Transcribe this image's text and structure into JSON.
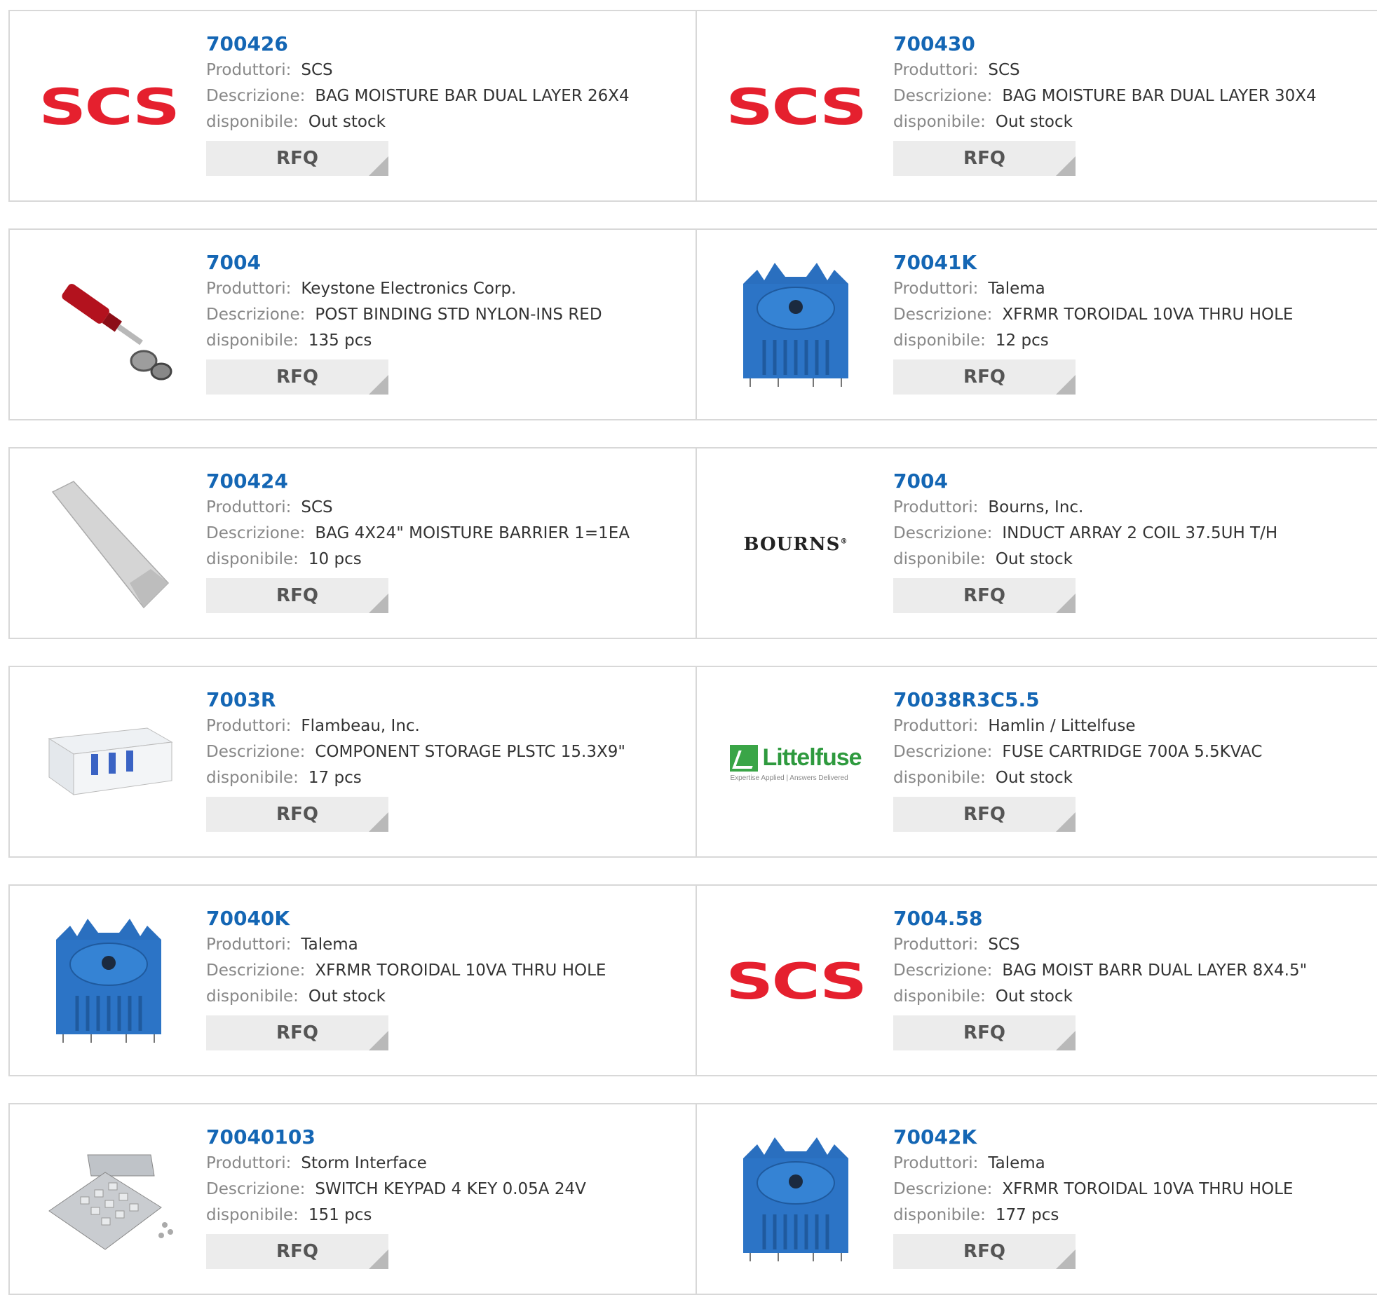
{
  "labels": {
    "manufacturer": "Produttori:",
    "description": "Descrizione:",
    "availability": "disponibile:"
  },
  "rfq_label": "RFQ",
  "brand_text": {
    "scs": "SCS",
    "bourns": "BOURNS",
    "littelfuse": "Littelfuse",
    "littelfuse_tagline": "Expertise Applied | Answers Delivered"
  },
  "colors": {
    "part_number": "#1466b4",
    "scs_red": "#e5202e",
    "littelfuse_green": "#2e9a3e",
    "talema_blue": "#2a6fbf"
  },
  "products": [
    {
      "pn": "700426",
      "manufacturer": "SCS",
      "description": "BAG MOISTURE BAR DUAL LAYER 26X4",
      "availability": "Out stock",
      "image": "scs-logo"
    },
    {
      "pn": "700430",
      "manufacturer": "SCS",
      "description": "BAG MOISTURE BAR DUAL LAYER 30X4",
      "availability": "Out stock",
      "image": "scs-logo"
    },
    {
      "pn": "7004",
      "manufacturer": "Keystone Electronics Corp.",
      "description": "POST BINDING STD NYLON-INS RED",
      "availability": "135 pcs",
      "image": "binding-post-photo"
    },
    {
      "pn": "70041K",
      "manufacturer": "Talema",
      "description": "XFRMR TOROIDAL 10VA THRU HOLE",
      "availability": "12 pcs",
      "image": "transformer-photo"
    },
    {
      "pn": "700424",
      "manufacturer": "SCS",
      "description": "BAG 4X24\" MOISTURE BARRIER 1=1EA",
      "availability": "10 pcs",
      "image": "bag-photo"
    },
    {
      "pn": "7004",
      "manufacturer": "Bourns, Inc.",
      "description": "INDUCT ARRAY 2 COIL 37.5UH T/H",
      "availability": "Out stock",
      "image": "bourns-logo"
    },
    {
      "pn": "7003R",
      "manufacturer": "Flambeau, Inc.",
      "description": "COMPONENT STORAGE PLSTC 15.3X9\"",
      "availability": "17 pcs",
      "image": "storage-box-photo"
    },
    {
      "pn": "70038R3C5.5",
      "manufacturer": "Hamlin / Littelfuse",
      "description": "FUSE CARTRIDGE 700A 5.5KVAC",
      "availability": "Out stock",
      "image": "littelfuse-logo"
    },
    {
      "pn": "70040K",
      "manufacturer": "Talema",
      "description": "XFRMR TOROIDAL 10VA THRU HOLE",
      "availability": "Out stock",
      "image": "transformer-photo"
    },
    {
      "pn": "7004.58",
      "manufacturer": "SCS",
      "description": "BAG MOIST BARR DUAL LAYER 8X4.5\"",
      "availability": "Out stock",
      "image": "scs-logo"
    },
    {
      "pn": "70040103",
      "manufacturer": "Storm Interface",
      "description": "SWITCH KEYPAD 4 KEY 0.05A 24V",
      "availability": "151 pcs",
      "image": "keypad-photo"
    },
    {
      "pn": "70042K",
      "manufacturer": "Talema",
      "description": "XFRMR TOROIDAL 10VA THRU HOLE",
      "availability": "177 pcs",
      "image": "transformer-photo"
    }
  ]
}
